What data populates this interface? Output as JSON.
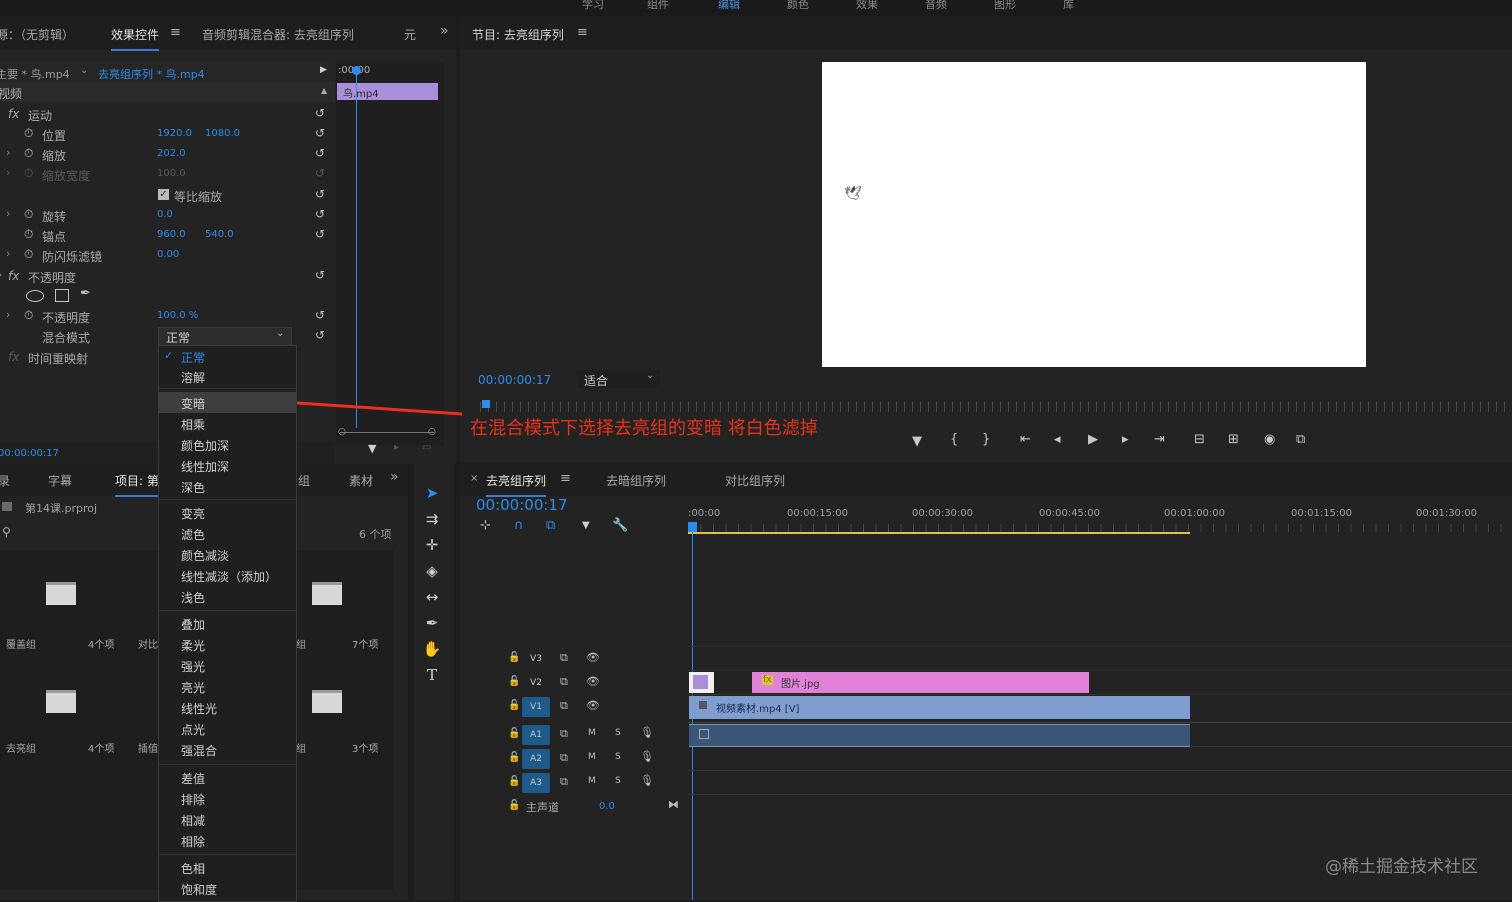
{
  "top_nav": {
    "items": [
      "学习",
      "组件",
      "编辑",
      "颜色",
      "效果",
      "音频",
      "图形",
      "库"
    ],
    "active_index": 2
  },
  "effect_panel": {
    "tabs": [
      "源：（无剪辑）",
      "效果控件",
      "音频剪辑混合器: 去亮组序列",
      "元"
    ],
    "overflow": "»",
    "source_clip": "主要 * 鸟.mp4",
    "sequence_clip": "去亮组序列 * 鸟.mp4",
    "timeline_start": ":00:00",
    "clip_label": "鸟.mp4",
    "section_video": "视频",
    "motion": "运动",
    "position": {
      "label": "位置",
      "x": "1920.0",
      "y": "1080.0"
    },
    "scale": {
      "label": "缩放",
      "value": "202.0"
    },
    "scale_width": {
      "label": "缩放宽度",
      "value": "100.0"
    },
    "uniform_scale": "等比缩放",
    "rotation": {
      "label": "旋转",
      "value": "0.0"
    },
    "anchor": {
      "label": "锚点",
      "x": "960.0",
      "y": "540.0"
    },
    "flicker": {
      "label": "防闪烁滤镜",
      "value": "0.00"
    },
    "opacity_section": "不透明度",
    "opacity": {
      "label": "不透明度",
      "value": "100.0 %"
    },
    "blend_mode": {
      "label": "混合模式",
      "value": "正常"
    },
    "time_remap": "时间重映射",
    "timecode": "00:00:00:17",
    "fx": "fx"
  },
  "blend_menu": {
    "groups": [
      [
        "正常",
        "溶解"
      ],
      [
        "变暗",
        "相乘",
        "颜色加深",
        "线性加深",
        "深色"
      ],
      [
        "变亮",
        "滤色",
        "颜色减淡",
        "线性减淡（添加）",
        "浅色"
      ],
      [
        "叠加",
        "柔光",
        "强光",
        "亮光",
        "线性光",
        "点光",
        "强混合"
      ],
      [
        "差值",
        "排除",
        "相减",
        "相除"
      ],
      [
        "色相",
        "饱和度"
      ]
    ],
    "selected": "正常",
    "highlighted": "变暗"
  },
  "project_panel": {
    "tabs": [
      "录",
      "字幕",
      "项目: 第",
      "组",
      "素材"
    ],
    "overflow": "»",
    "project_file": "第14课.prproj",
    "item_count": "6 个项",
    "bins": [
      {
        "name": "覆盖组",
        "count": "4个项"
      },
      {
        "name": "对比",
        "count": ""
      },
      {
        "name": "组",
        "count": "7个项"
      },
      {
        "name": "去亮组",
        "count": "4个项"
      },
      {
        "name": "插值",
        "count": ""
      },
      {
        "name": "组",
        "count": "3个项"
      }
    ]
  },
  "program_monitor": {
    "title": "节目: 去亮组序列",
    "timecode": "00:00:00:17",
    "fit": "适合"
  },
  "annotation": "在混合模式下选择去亮组的变暗 将白色滤掉",
  "timeline": {
    "tabs": [
      "去亮组序列",
      "去暗组序列",
      "对比组序列"
    ],
    "timecode": "00:00:00:17",
    "ruler": [
      ":00:00",
      "00:00:15:00",
      "00:00:30:00",
      "00:00:45:00",
      "00:01:00:00",
      "00:01:15:00",
      "00:01:30:00"
    ],
    "tracks": [
      {
        "name": "V3"
      },
      {
        "name": "V2"
      },
      {
        "name": "V1"
      },
      {
        "name": "A1"
      },
      {
        "name": "A2"
      },
      {
        "name": "A3"
      }
    ],
    "master": {
      "label": "主声道",
      "value": "0.0"
    },
    "clips": {
      "v2": "图片.jpg",
      "v1": "视频素材.mp4 [V]",
      "fx": "fx"
    },
    "m": "M",
    "s": "S"
  },
  "watermark": "@稀土掘金技术社区",
  "colors": {
    "accent": "#2d8ceb",
    "annotation": "#e8301c",
    "clip_video": "#7e9ed0",
    "clip_image": "#e082d8",
    "clip_mp4": "#a88fd9",
    "audio_clip": "#3b5577"
  }
}
